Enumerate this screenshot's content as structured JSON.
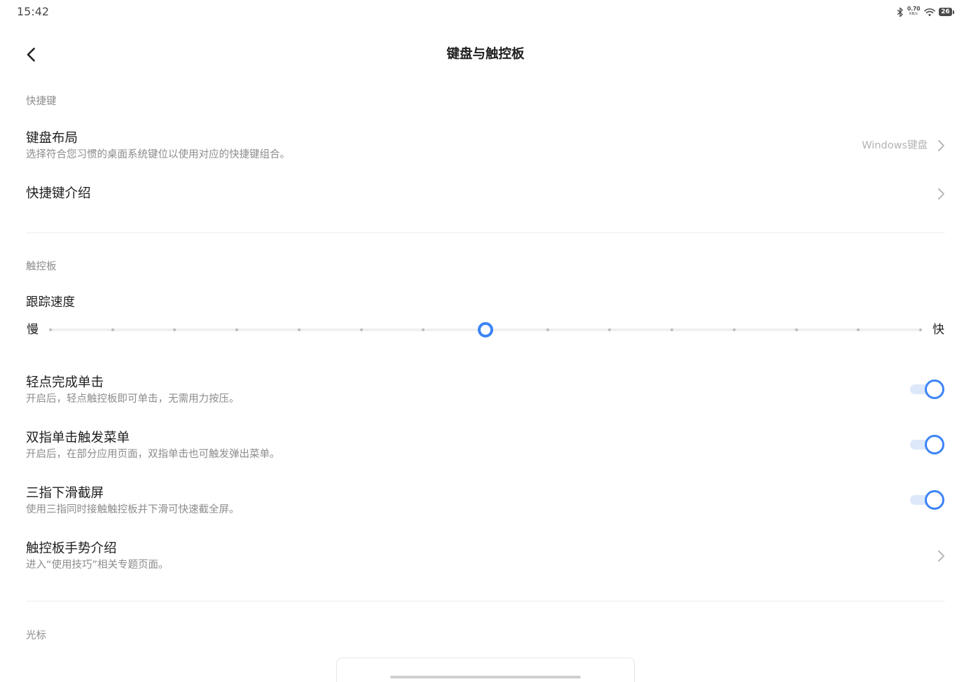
{
  "colors": {
    "text": "#1f1f1f",
    "secondary": "#8c8c8c",
    "value": "#b3b3b3",
    "chevron": "#b8b8b8",
    "divider": "#eeeeee",
    "accent": "#3d84f6",
    "accent_light": "#dde8fb",
    "slider_track": "#f0f0f0",
    "slider_dot": "#bdbdbd",
    "status": "#4a4a4a"
  },
  "status_bar": {
    "time": "15:42",
    "net_speed": "0.70",
    "net_unit": "KB/s",
    "battery": "26",
    "icons": [
      "bluetooth-icon",
      "wifi-icon",
      "battery-icon"
    ]
  },
  "header": {
    "title": "键盘与触控板",
    "back_icon": "chevron-left-icon"
  },
  "shortcuts": {
    "label": "快捷键",
    "keyboard_layout": {
      "title": "键盘布局",
      "subtitle": "选择符合您习惯的桌面系统键位以使用对应的快捷键组合。",
      "value": "Windows键盘",
      "icon": "chevron-right-icon"
    },
    "shortcut_intro": {
      "title": "快捷键介绍",
      "icon": "chevron-right-icon"
    }
  },
  "touchpad": {
    "label": "触控板",
    "tracking_speed": {
      "title": "跟踪速度",
      "min_label": "慢",
      "max_label": "快",
      "levels": 15,
      "level": 8
    },
    "tap_to_click": {
      "title": "轻点完成单击",
      "subtitle": "开启后，轻点触控板即可单击，无需用力按压。",
      "enabled": true
    },
    "two_finger_menu": {
      "title": "双指单击触发菜单",
      "subtitle": "开启后，在部分应用页面，双指单击也可触发弹出菜单。",
      "enabled": true
    },
    "three_finger_screenshot": {
      "title": "三指下滑截屏",
      "subtitle": "使用三指同时接触触控板并下滑可快速截全屏。",
      "enabled": true
    },
    "gesture_intro": {
      "title": "触控板手势介绍",
      "subtitle": "进入“使用技巧”相关专题页面。",
      "icon": "chevron-right-icon"
    }
  },
  "cursor": {
    "label": "光标"
  }
}
